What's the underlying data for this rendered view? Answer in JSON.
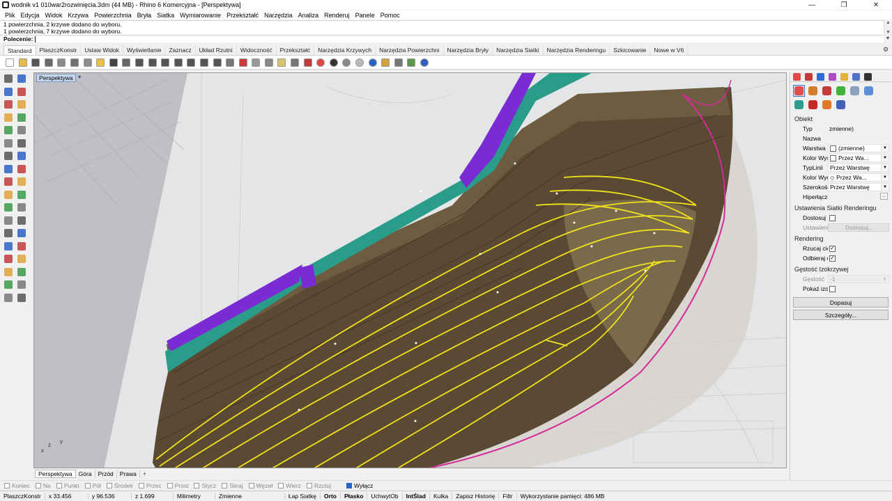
{
  "window": {
    "title": "wodnik v1 010war2rozwinięcia.3dm (44 MB) - Rhino 6 Komercyjna - [Perspektywa]",
    "controls": [
      "—",
      "❐",
      "✕"
    ]
  },
  "menu": [
    "Plik",
    "Edycja",
    "Widok",
    "Krzywa",
    "Powierzchnia",
    "Bryła",
    "Siatka",
    "Wymiarowanie",
    "Przekształć",
    "Narzędzia",
    "Analiza",
    "Renderuj",
    "Panele",
    "Pomoc"
  ],
  "command": {
    "history": [
      "1 powierzchnia, 2 krzywe dodano do wyboru.",
      "1 powierzchnia, 7 krzywe dodano do wyboru."
    ],
    "prompt": "Polecenie:"
  },
  "tabs": [
    "Standard",
    "PlaszczKonstr",
    "Ustaw Widok",
    "Wyświetlanie",
    "Zaznacz",
    "Układ Rzutni",
    "Widoczność",
    "Przekształć",
    "Narzędzia Krzywych",
    "Narzędzia Powierzchni",
    "Narzędzia Bryły",
    "Narzędzia Siatki",
    "Narzędzia Renderingu",
    "Szkicowanie",
    "Nowe w V6"
  ],
  "toolbar_icons": [
    {
      "name": "new-icon",
      "color": "#ffffff"
    },
    {
      "name": "open-icon",
      "color": "#e9b949"
    },
    {
      "name": "save-icon",
      "color": "#555555"
    },
    {
      "name": "print-icon",
      "color": "#6a6a6a"
    },
    {
      "name": "import-icon",
      "color": "#8a8a8a"
    },
    {
      "name": "cut-icon",
      "color": "#707070"
    },
    {
      "name": "copy-icon",
      "color": "#8c8c8c"
    },
    {
      "name": "paste-icon",
      "color": "#e6c24a"
    },
    {
      "name": "undo-icon",
      "color": "#444444"
    },
    {
      "name": "pan-icon",
      "color": "#666666"
    },
    {
      "name": "rotate-view-icon",
      "color": "#555555"
    },
    {
      "name": "zoom-icon",
      "color": "#555555"
    },
    {
      "name": "zoom-window-icon",
      "color": "#555555"
    },
    {
      "name": "zoom-extents-icon",
      "color": "#555555"
    },
    {
      "name": "zoom-selected-icon",
      "color": "#555555"
    },
    {
      "name": "undo-view-icon",
      "color": "#555555"
    },
    {
      "name": "four-views-icon",
      "color": "#555555"
    },
    {
      "name": "cplane-icon",
      "color": "#777777"
    },
    {
      "name": "select-icon",
      "color": "#cc3b3b"
    },
    {
      "name": "layer-icon",
      "color": "#999999"
    },
    {
      "name": "osnap-icon",
      "color": "#888888"
    },
    {
      "name": "light-icon",
      "color": "#d8c46a"
    },
    {
      "name": "lock-icon",
      "color": "#777777"
    },
    {
      "name": "material-icon",
      "color": "#c23b3b"
    },
    {
      "name": "color-wheel-icon",
      "color": "#e04848"
    },
    {
      "name": "render-sphere-icon",
      "color": "#333333"
    },
    {
      "name": "shaded-sphere-icon",
      "color": "#888888"
    },
    {
      "name": "ghost-sphere-icon",
      "color": "#bbbbbb"
    },
    {
      "name": "rendered-sphere-icon",
      "color": "#2a62c7"
    },
    {
      "name": "properties-icon",
      "color": "#d2a13d"
    },
    {
      "name": "options-icon",
      "color": "#777777"
    },
    {
      "name": "grasshopper-icon",
      "color": "#5a9a4a"
    },
    {
      "name": "help-icon",
      "color": "#2d5fc1"
    }
  ],
  "palette_icons": [
    [
      "select-arrow-icon",
      "point-icon"
    ],
    [
      "polyline-icon",
      "curve-icon"
    ],
    [
      "circle-icon",
      "ellipse-icon"
    ],
    [
      "arc-icon",
      "rectangle-icon"
    ],
    [
      "polygon-icon",
      "freeform-icon"
    ],
    [
      "box-edit-icon",
      "box-explode-icon"
    ],
    [
      "sphere-icon",
      "cylinder-icon"
    ],
    [
      "extrude-icon",
      "surface-icon"
    ],
    [
      "boolean-icon",
      "fillet-icon"
    ],
    [
      "split-icon",
      "trim-icon"
    ],
    [
      "join-icon",
      "explode-icon"
    ],
    [
      "move-icon",
      "rotate-icon"
    ],
    [
      "text-icon",
      "dimension-icon"
    ],
    [
      "array-icon",
      "mirror-icon"
    ],
    [
      "mesh-icon",
      "analyze-icon"
    ],
    [
      "grid-icon",
      "check-icon"
    ],
    [
      "render-icon",
      "paint-icon"
    ],
    [
      "block-icon",
      "group-icon"
    ]
  ],
  "viewport": {
    "name": "Perspektywa",
    "axis_y": "y",
    "axis_z": "z",
    "axis_x": "x"
  },
  "viewport_tabs": [
    "Perspektywa",
    "Góra",
    "Przód",
    "Prawa"
  ],
  "viewport_tab_add": "+",
  "osnaps": [
    {
      "label": "Koniec",
      "on": false
    },
    {
      "label": "Na",
      "on": false
    },
    {
      "label": "Punkt",
      "on": false
    },
    {
      "label": "Pół",
      "on": false
    },
    {
      "label": "Środek",
      "on": false
    },
    {
      "label": "Przec",
      "on": false
    },
    {
      "label": "Prost",
      "on": false
    },
    {
      "label": "Stycz",
      "on": false
    },
    {
      "label": "Skraj",
      "on": false
    },
    {
      "label": "Węzeł",
      "on": false
    },
    {
      "label": "Wierz",
      "on": false
    },
    {
      "label": "Rzutuj",
      "on": false
    },
    {
      "label": "Wyłącz",
      "on": true
    }
  ],
  "status": {
    "cplane": "PlaszczKonstr",
    "x": "x 33.456",
    "y": "y 96.536",
    "z": "z 1.699",
    "units": "Milimetry",
    "layer": "Zmienne",
    "lap_siatke": "Łap Siatkę",
    "orto": "Orto",
    "plasko": "Płasko",
    "uchwyt": "UchwytOb",
    "inslad": "IntŚlad",
    "kulka": "Kulka",
    "zapisz": "Zapisz Historię",
    "filtr": "Filtr",
    "memory": "Wykorzystanie pamięci: 486 MB"
  },
  "right_panel": {
    "tab_icons": [
      {
        "name": "properties-tab-icon",
        "color": "#e24848"
      },
      {
        "name": "layers-tab-icon",
        "color": "#c23a3a"
      },
      {
        "name": "render-tab-icon",
        "color": "#2f6bd1"
      },
      {
        "name": "materials-tab-icon",
        "color": "#b04ac2"
      },
      {
        "name": "libraries-tab-icon",
        "color": "#e2b23a"
      },
      {
        "name": "display-tab-icon",
        "color": "#5073c6"
      },
      {
        "name": "help-tab-icon",
        "color": "#333333"
      }
    ],
    "prop_icons": [
      {
        "name": "object-props-icon",
        "color": "#e34c4c",
        "selected": true
      },
      {
        "name": "curve-props-icon",
        "color": "#d87b2a",
        "selected": false
      },
      {
        "name": "material-props-icon",
        "color": "#c23b3b",
        "selected": false
      },
      {
        "name": "texture-props-icon",
        "color": "#41b23a",
        "selected": false
      },
      {
        "name": "decal-props-icon",
        "color": "#8aa1c0",
        "selected": false
      },
      {
        "name": "mapping-props-icon",
        "color": "#5e8fd9",
        "selected": false
      },
      {
        "name": "environment-props-icon",
        "color": "#2e9e8c",
        "selected": false
      },
      {
        "name": "shadow-props-icon",
        "color": "#c42828",
        "selected": false
      },
      {
        "name": "sun-props-icon",
        "color": "#e07a2a",
        "selected": false
      },
      {
        "name": "mesh-props-icon",
        "color": "#4063b8",
        "selected": false
      }
    ],
    "sections": {
      "obiekt": "Obiekt",
      "siatka": "Ustawienia Siatki Renderingu",
      "rendering": "Rendering",
      "izokrzywe": "Gęstość Izokrzywej"
    },
    "props": {
      "typ": {
        "key": "Typ",
        "value": "zmienne)"
      },
      "nazwa": {
        "key": "Nazwa",
        "value": ""
      },
      "warstwa": {
        "key": "Warstwa",
        "value": "(zmienne)"
      },
      "kolor_wysw": {
        "key": "Kolor Wyświ...",
        "value": "Przez Wa..."
      },
      "typ_linii": {
        "key": "TypLinii",
        "value": "Przez Warstwę"
      },
      "kolor_wydr": {
        "key": "Kolor Wydru...",
        "value": "Przez Wa..."
      },
      "szerokosc": {
        "key": "Szerokość W...",
        "value": "Przez Warstwę"
      },
      "hiperlacze": {
        "key": "Hiperłącze",
        "value": "..."
      },
      "dostosuj": {
        "key": "Dostosuj Siat...",
        "value": ""
      },
      "ustawienia": {
        "key": "Ustawienia",
        "value": "Dostosuj..."
      },
      "rzucaj": {
        "key": "Rzucaj cienie",
        "value": "✓"
      },
      "odbieraj": {
        "key": "Odbieraj cie...",
        "value": "✓"
      },
      "gestosc": {
        "key": "Gęstość",
        "value": "-1"
      },
      "pokaz": {
        "key": "Pokaż izokrz...",
        "value": ""
      }
    },
    "buttons": {
      "dopasuj": "Dopasuj",
      "szczegoly": "Szczegóły..."
    }
  }
}
